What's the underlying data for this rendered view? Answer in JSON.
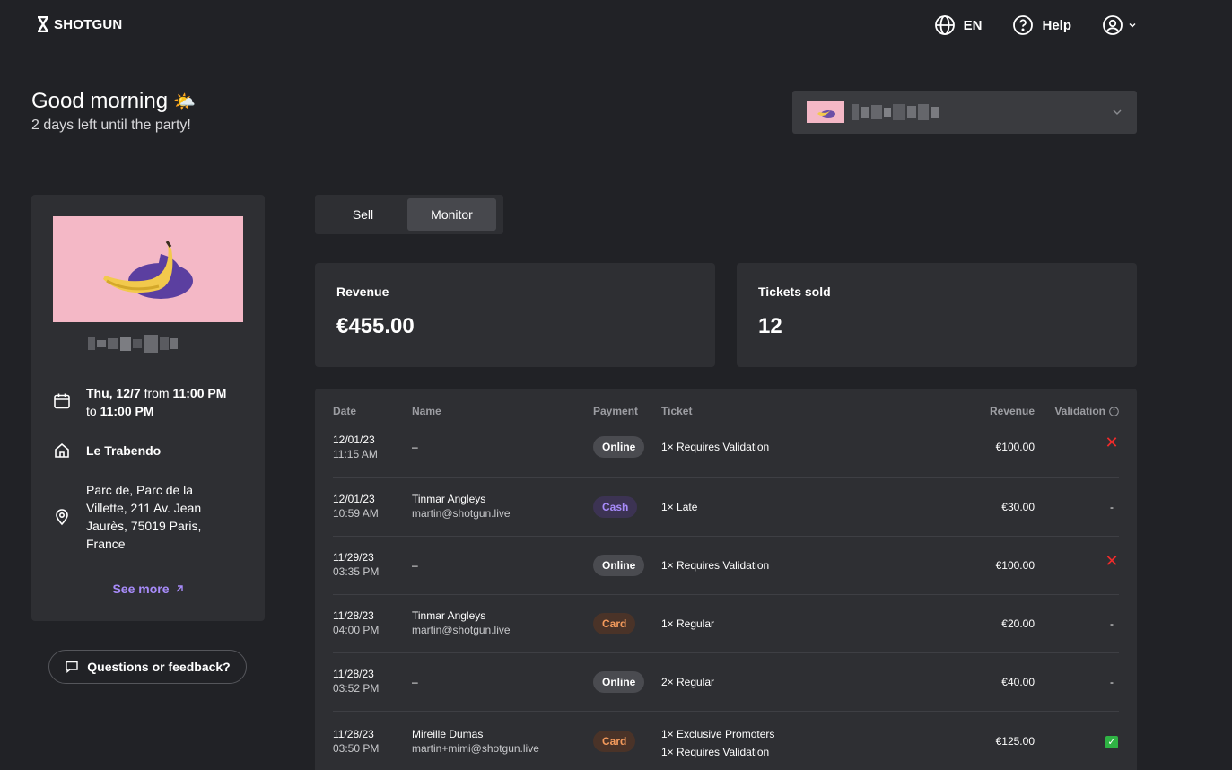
{
  "header": {
    "logo_text": "SHOTGUN",
    "language": "EN",
    "help_label": "Help"
  },
  "greeting": {
    "title": "Good morning",
    "emoji": "🌤️",
    "subtitle": "2 days left until the party!"
  },
  "tabs": [
    {
      "label": "Sell",
      "active": false
    },
    {
      "label": "Monitor",
      "active": true
    }
  ],
  "event": {
    "date_day": "Thu, 12/7",
    "date_from_word": "from",
    "date_from_time": "11:00 PM",
    "date_to_word": "to",
    "date_to_time": "11:00 PM",
    "venue": "Le Trabendo",
    "address": "Parc de, Parc de la Villette, 211 Av. Jean Jaurès, 75019 Paris, France",
    "see_more": "See more"
  },
  "feedback_label": "Questions or feedback?",
  "stats": {
    "revenue_label": "Revenue",
    "revenue_value": "€455.00",
    "tickets_label": "Tickets sold",
    "tickets_value": "12"
  },
  "table": {
    "headers": {
      "date": "Date",
      "name": "Name",
      "payment": "Payment",
      "ticket": "Ticket",
      "revenue": "Revenue",
      "validation": "Validation"
    },
    "rows": [
      {
        "date": "12/01/23",
        "time": "11:15 AM",
        "name": "–",
        "email": "",
        "payment": "Online",
        "ticket1": "1× Requires Validation",
        "ticket2": "",
        "revenue": "€100.00",
        "validation": "✕"
      },
      {
        "date": "12/01/23",
        "time": "10:59 AM",
        "name": "Tinmar Angleys",
        "email": "martin@shotgun.live",
        "payment": "Cash",
        "ticket1": "1× Late",
        "ticket2": "",
        "revenue": "€30.00",
        "validation": "-"
      },
      {
        "date": "11/29/23",
        "time": "03:35 PM",
        "name": "–",
        "email": "",
        "payment": "Online",
        "ticket1": "1× Requires Validation",
        "ticket2": "",
        "revenue": "€100.00",
        "validation": "✕"
      },
      {
        "date": "11/28/23",
        "time": "04:00 PM",
        "name": "Tinmar Angleys",
        "email": "martin@shotgun.live",
        "payment": "Card",
        "ticket1": "1× Regular",
        "ticket2": "",
        "revenue": "€20.00",
        "validation": "-"
      },
      {
        "date": "11/28/23",
        "time": "03:52 PM",
        "name": "–",
        "email": "",
        "payment": "Online",
        "ticket1": "2× Regular",
        "ticket2": "",
        "revenue": "€40.00",
        "validation": "-"
      },
      {
        "date": "11/28/23",
        "time": "03:50 PM",
        "name": "Mireille Dumas",
        "email": "martin+mimi@shotgun.live",
        "payment": "Card",
        "ticket1": "1× Exclusive Promoters",
        "ticket2": "1× Requires Validation",
        "revenue": "€125.00",
        "validation": "✓"
      }
    ]
  },
  "colors": {
    "background": "#212226",
    "card": "#2e2f33",
    "accent_purple": "#a78bfa",
    "card_orange": "#f39a5c",
    "error_red": "#ef2b2b",
    "success_green": "#2fb344"
  }
}
